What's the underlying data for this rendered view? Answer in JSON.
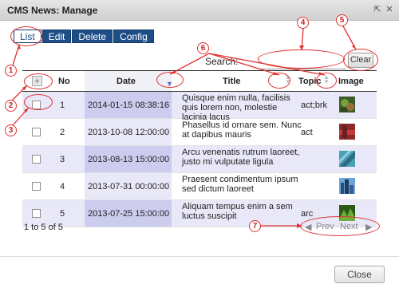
{
  "window": {
    "title": "CMS News: Manage"
  },
  "tabs": [
    {
      "label": "List"
    },
    {
      "label": "Edit"
    },
    {
      "label": "Delete"
    },
    {
      "label": "Config"
    }
  ],
  "search": {
    "label": "Search:",
    "value": "",
    "clear_label": "Clear"
  },
  "table": {
    "add_symbol": "+",
    "columns": [
      "No",
      "Date",
      "Title",
      "Topic",
      "Image"
    ],
    "rows": [
      {
        "no": "1",
        "date": "2014-01-15 08:38:16",
        "title": "Quisque enim nulla, facilisis quis lorem non, molestie lacinia lacus",
        "topic": "act;brk",
        "image": "thumbnail"
      },
      {
        "no": "2",
        "date": "2013-10-08 12:00:00",
        "title": "Phasellus id ornare sem. Nunc at dapibus mauris",
        "topic": "act",
        "image": "thumbnail"
      },
      {
        "no": "3",
        "date": "2013-08-13 15:00:00",
        "title": "Arcu venenatis rutrum laoreet, justo mi vulputate ligula",
        "topic": "",
        "image": "thumbnail"
      },
      {
        "no": "4",
        "date": "2013-07-31 00:00:00",
        "title": "Praesent condimentum ipsum sed dictum laoreet",
        "topic": "",
        "image": "thumbnail"
      },
      {
        "no": "5",
        "date": "2013-07-25 15:00:00",
        "title": "Aliquam tempus enim a sem luctus suscipit",
        "topic": "arc",
        "image": "thumbnail"
      }
    ]
  },
  "footer": {
    "count": "1 to 5 of 5",
    "prev_label": "Prev",
    "next_label": "Next"
  },
  "close_label": "Close",
  "annotations": [
    "1",
    "2",
    "3",
    "4",
    "5",
    "6",
    "7"
  ],
  "colors": {
    "tab_bg": "#1d4e87",
    "annotation": "#e03030",
    "row_alt": "#e8e8f9",
    "sort_active": "#5a69c8"
  }
}
